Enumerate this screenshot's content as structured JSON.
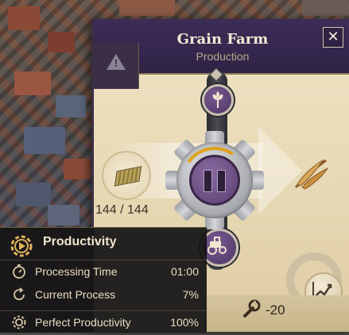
{
  "panel": {
    "title": "Grain Farm",
    "subtitle": "Production",
    "close_label": "✕",
    "input_stock": "144 / 144",
    "upkeep": "-20",
    "state": "paused"
  },
  "productivity": {
    "title": "Productivity",
    "rows": [
      {
        "label": "Processing Time",
        "value": "01:00",
        "icon": "clock-icon"
      },
      {
        "label": "Current Process",
        "value": "7%",
        "icon": "refresh-icon"
      },
      {
        "label": "Perfect Productivity",
        "value": "100%",
        "icon": "gear-icon"
      }
    ]
  },
  "colors": {
    "header_purple": "#3c2c57",
    "parchment": "#efe3c4",
    "progress_orange": "#e0a21a",
    "pause_purple": "#6a4c84"
  }
}
